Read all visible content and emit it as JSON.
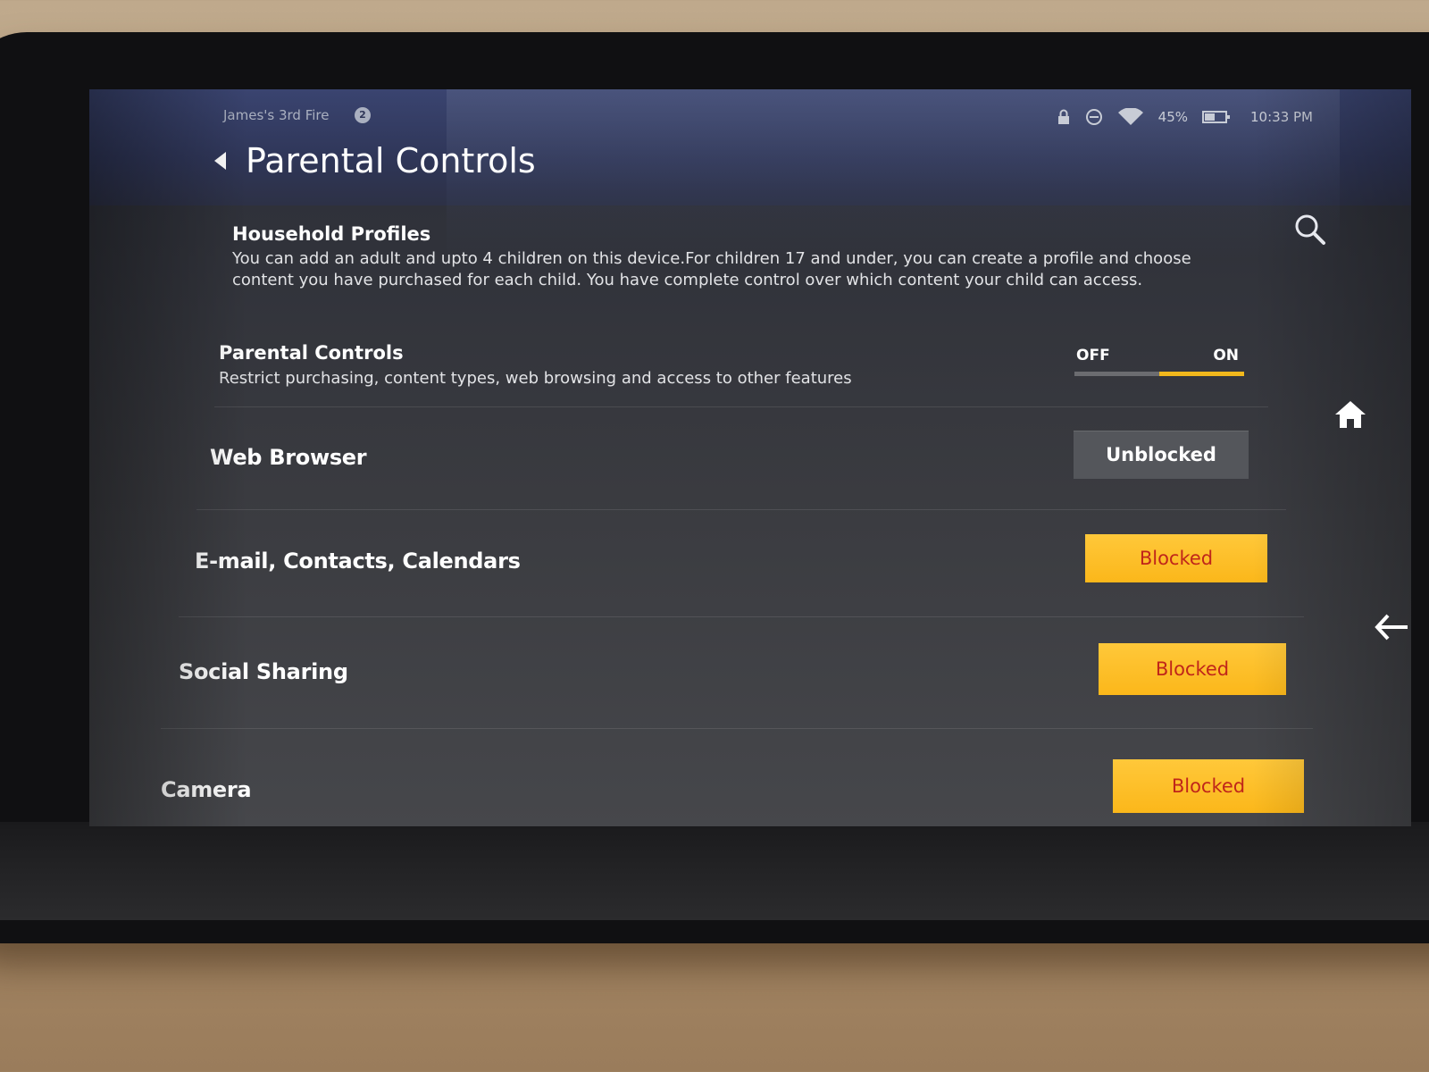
{
  "status_bar": {
    "device_name": "James's 3rd Fire",
    "notification_count": "2",
    "battery_percent": "45%",
    "time": "10:33 PM",
    "icons": [
      "lock-icon",
      "do-not-disturb-icon",
      "wifi-icon",
      "battery-icon"
    ]
  },
  "header": {
    "title": "Parental Controls",
    "back_icon": "back-chevron-icon"
  },
  "household_profiles": {
    "title": "Household Profiles",
    "description": "You can add an adult and upto 4 children on this device.For children 17 and under, you can create a profile and choose content you have purchased for each child. You have complete control over which content your child can access."
  },
  "parental_controls": {
    "title": "Parental Controls",
    "description": "Restrict purchasing, content types, web browsing and access to other features",
    "toggle": {
      "off_label": "OFF",
      "on_label": "ON",
      "state": "on"
    }
  },
  "settings": [
    {
      "label": "Web Browser",
      "status": "Unblocked"
    },
    {
      "label": "E-mail, Contacts, Calendars",
      "status": "Blocked"
    },
    {
      "label": "Social Sharing",
      "status": "Blocked"
    },
    {
      "label": "Camera",
      "status": "Blocked"
    }
  ],
  "nav": {
    "icons": [
      "search-icon",
      "home-icon",
      "back-arrow-icon"
    ]
  },
  "colors": {
    "accent": "#f2b81c",
    "blocked_text": "#c0261a",
    "unblocked_bg": "#54565b"
  }
}
